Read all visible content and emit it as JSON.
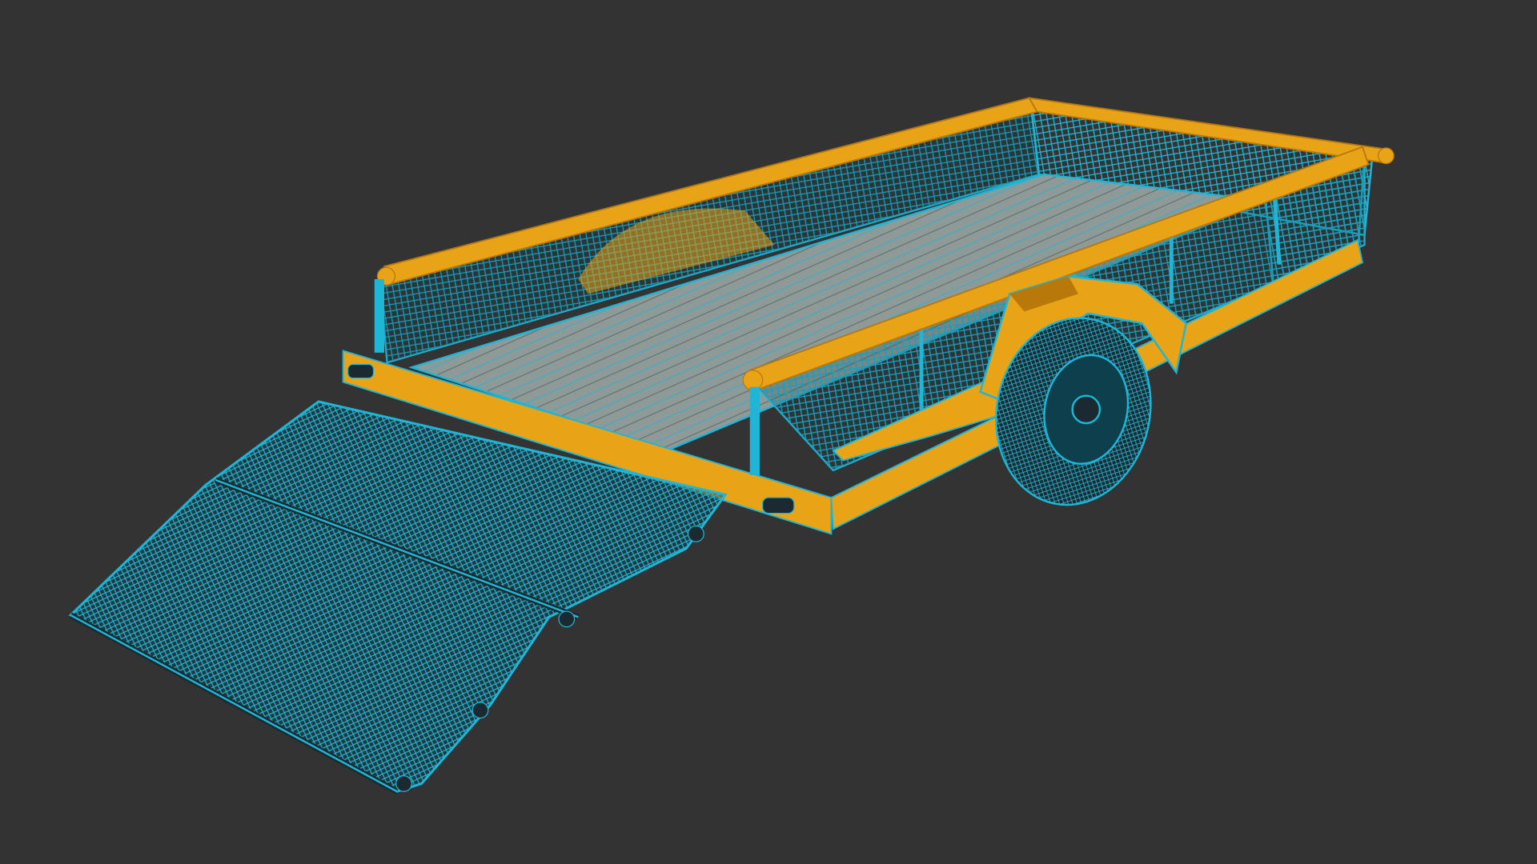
{
  "scene": {
    "subject": "utility-trailer-wireframe-render",
    "colors": {
      "background": "#333333",
      "frame": "#E8A317",
      "frame_dark": "#B9780A",
      "wire": "#1FB5D6",
      "wire_dark": "#0E6E86",
      "deck": "#8E9A98",
      "deck_dark": "#5D6867",
      "tire": "#1b2a30",
      "mesh_dark": "#0d3f4d"
    }
  }
}
